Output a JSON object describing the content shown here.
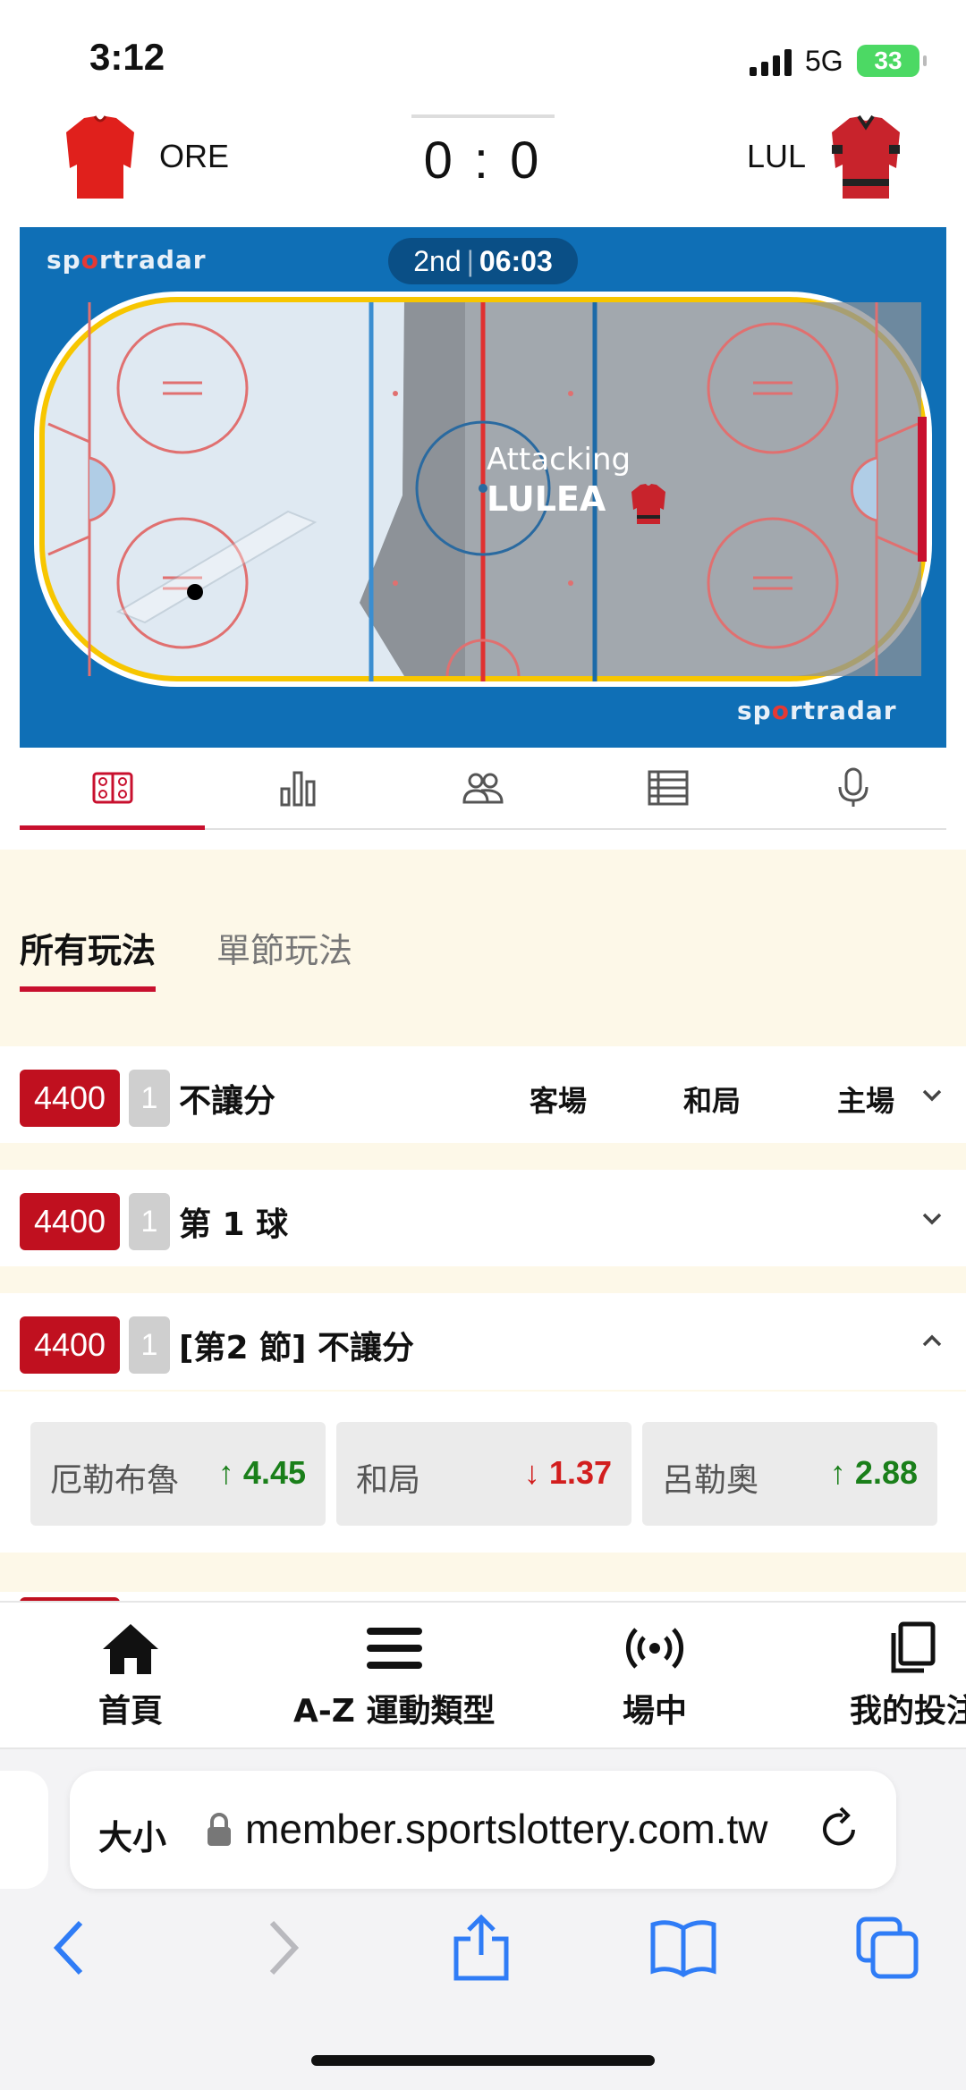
{
  "status_bar": {
    "time": "3:12",
    "network": "5G",
    "battery": "33"
  },
  "match": {
    "home_team": "ORE",
    "away_team": "LUL",
    "score": "0 : 0",
    "home_color": "#e0201c",
    "away_color": "#c8232c"
  },
  "tracker": {
    "brand_prefix": "sp",
    "brand_dot": "o",
    "brand_suffix": "rtradar",
    "period": "2nd",
    "separator": "|",
    "clock": "06:03",
    "attacking_label": "Attacking",
    "attacking_team": "LULEA"
  },
  "tabs": [
    {
      "icon": "rink-icon",
      "active": true
    },
    {
      "icon": "stats-chart-icon",
      "active": false
    },
    {
      "icon": "lineup-icon",
      "active": false
    },
    {
      "icon": "table-list-icon",
      "active": false
    },
    {
      "icon": "microphone-icon",
      "active": false
    }
  ],
  "bet_tabs": {
    "all": "所有玩法",
    "period": "單節玩法"
  },
  "markets": [
    {
      "code": "4400",
      "num": "1",
      "title": "不讓分",
      "cols": [
        "客場",
        "和局",
        "主場"
      ],
      "expanded": false
    },
    {
      "code": "4400",
      "num": "1",
      "title": "第 1 球",
      "cols": [],
      "expanded": false
    },
    {
      "code": "4400",
      "num": "1",
      "title": "[第2 節] 不讓分",
      "cols": [],
      "expanded": true
    }
  ],
  "odds": [
    {
      "name": "厄勒布魯",
      "arrow": "↑",
      "value": "4.45",
      "trend": "up"
    },
    {
      "name": "和局",
      "arrow": "↓",
      "value": "1.37",
      "trend": "down"
    },
    {
      "name": "呂勒奧",
      "arrow": "↑",
      "value": "2.88",
      "trend": "up"
    }
  ],
  "bottom_nav": [
    {
      "icon": "home-icon",
      "label": "首頁"
    },
    {
      "icon": "menu-icon",
      "label": "A-Z 運動類型"
    },
    {
      "icon": "live-icon",
      "label": "場中"
    },
    {
      "icon": "documents-icon",
      "label": "我的投注"
    }
  ],
  "safari": {
    "text_size": "大小",
    "url": "member.sportslottery.com.tw"
  },
  "colors": {
    "accent": "#c8102e",
    "rink_blue": "#0f6fb6",
    "odds_up": "#1a7f1a",
    "odds_down": "#d21e1e"
  }
}
